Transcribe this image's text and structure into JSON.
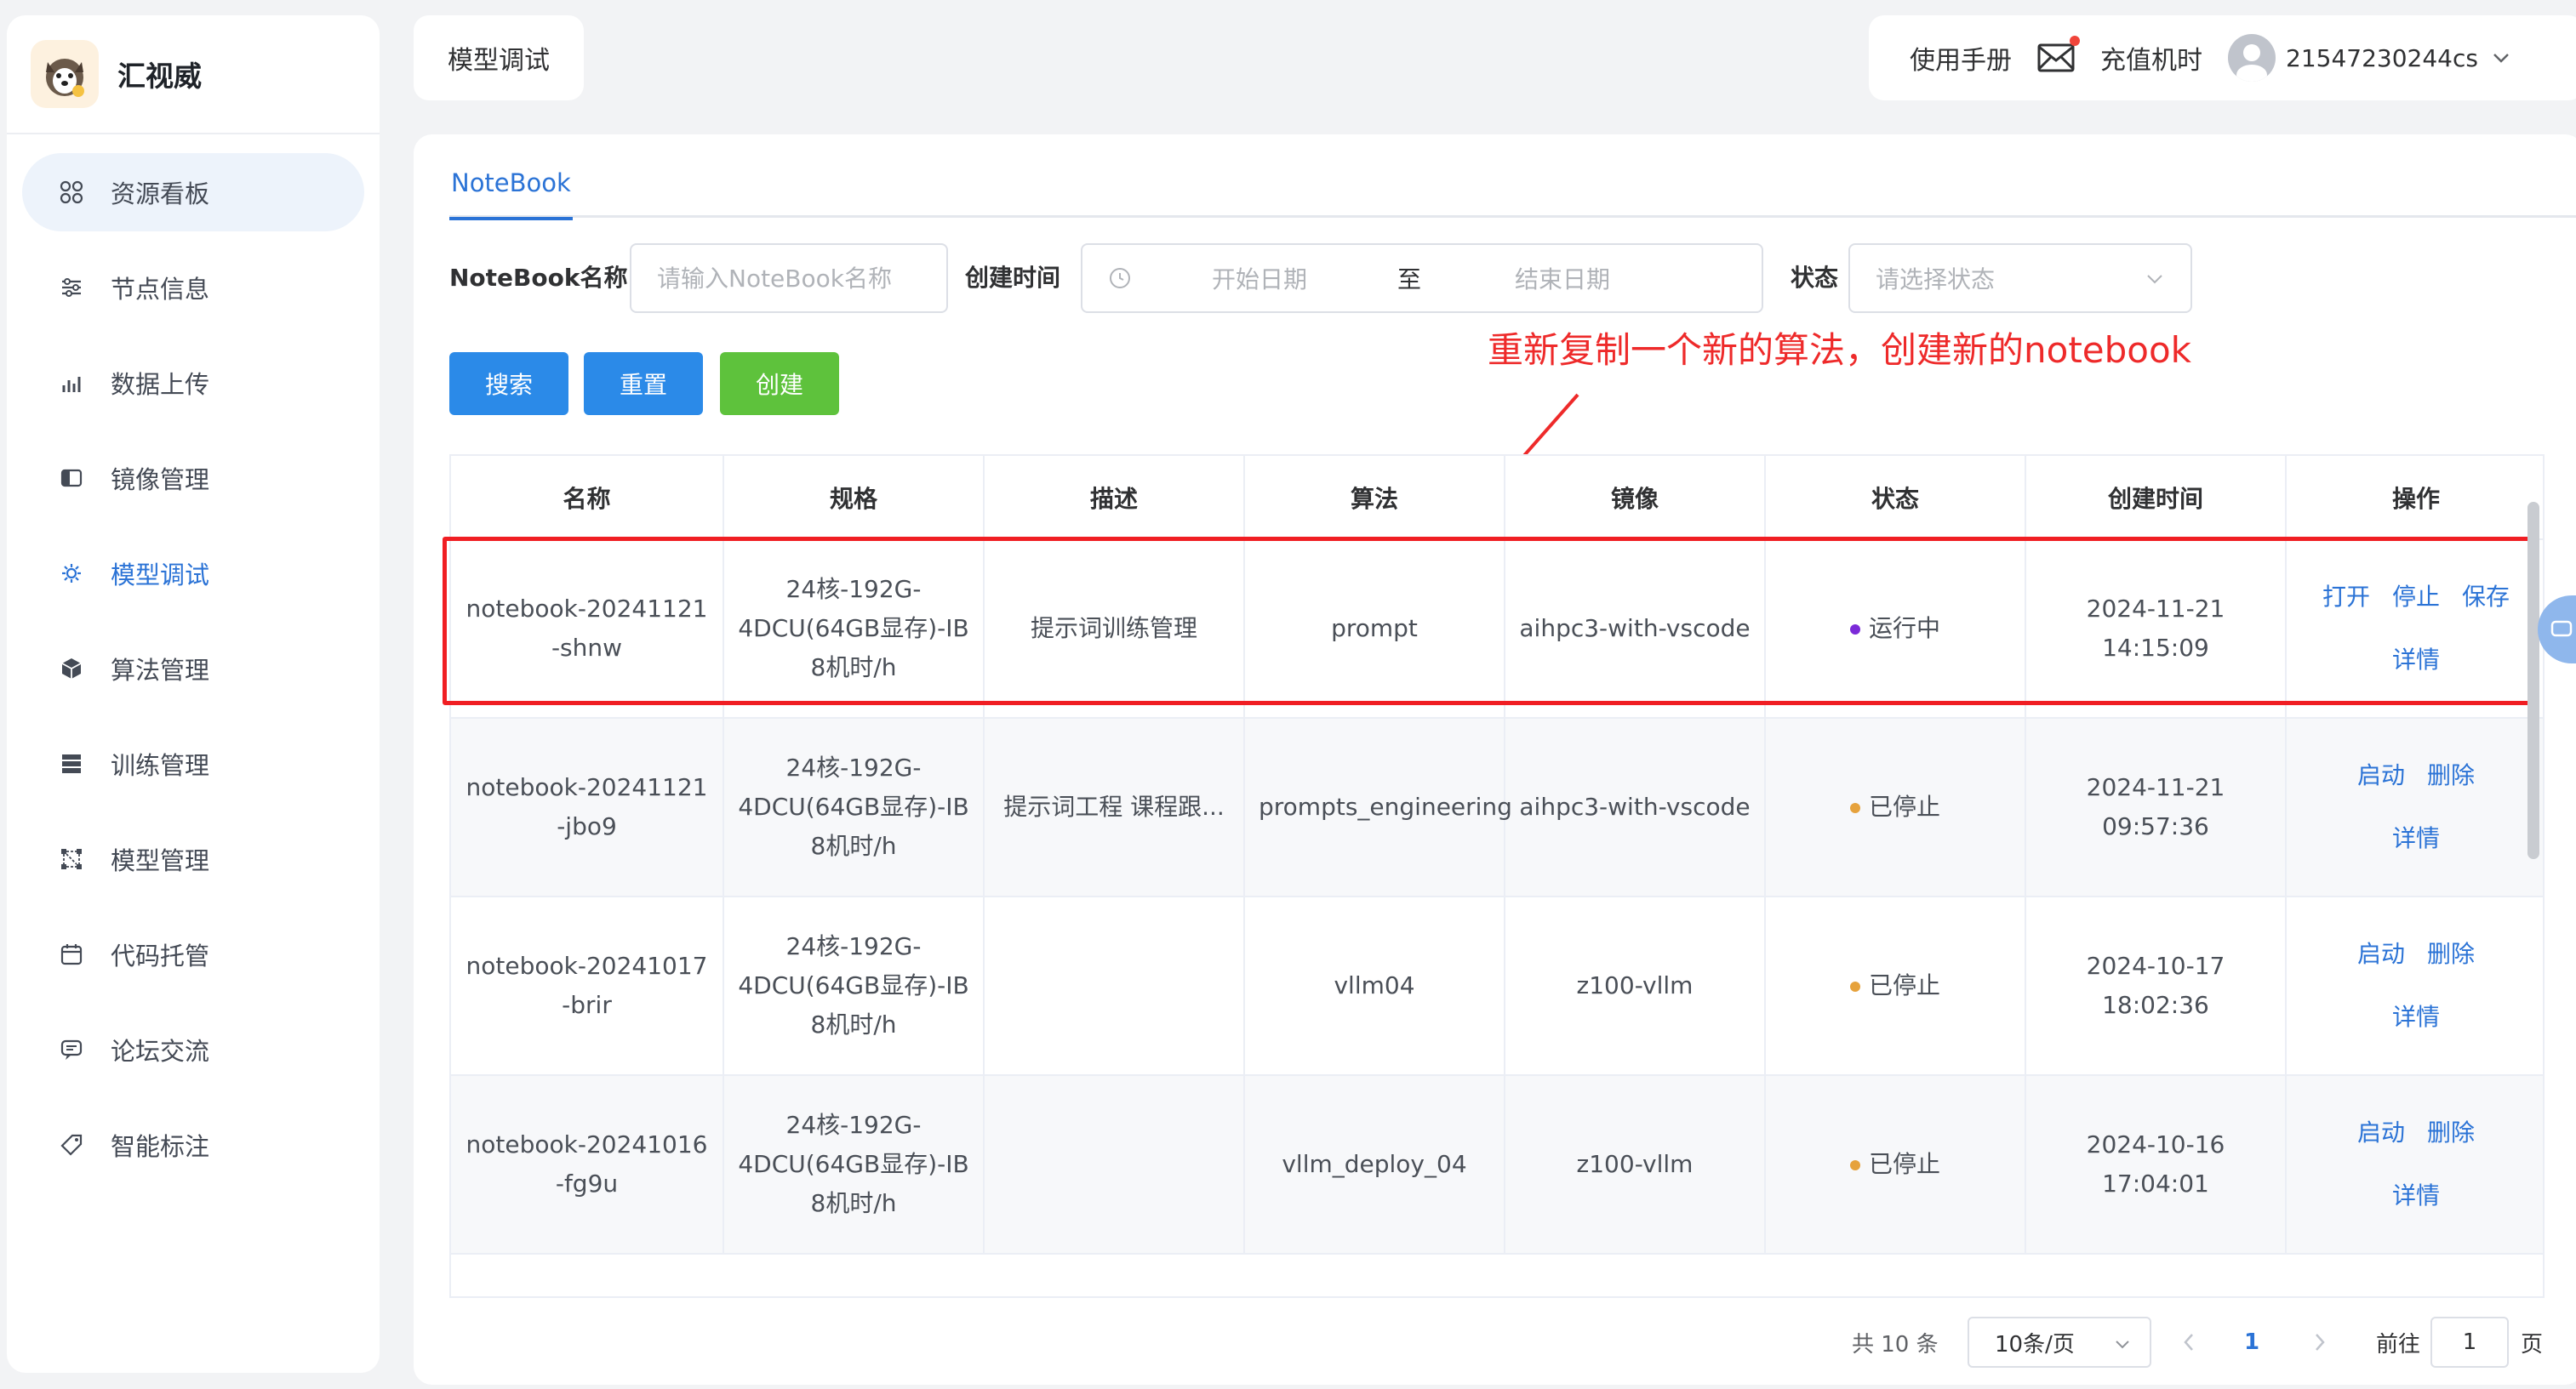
{
  "brand": {
    "name": "汇视威"
  },
  "sidebar": {
    "items": [
      {
        "label": "资源看板",
        "icon": "grid-icon"
      },
      {
        "label": "节点信息",
        "icon": "sliders-icon"
      },
      {
        "label": "数据上传",
        "icon": "bar-chart-icon"
      },
      {
        "label": "镜像管理",
        "icon": "image-icon"
      },
      {
        "label": "模型调试",
        "icon": "cog-icon"
      },
      {
        "label": "算法管理",
        "icon": "cube-icon"
      },
      {
        "label": "训练管理",
        "icon": "server-icon"
      },
      {
        "label": "模型管理",
        "icon": "nodes-icon"
      },
      {
        "label": "代码托管",
        "icon": "calendar-icon"
      },
      {
        "label": "论坛交流",
        "icon": "chat-icon"
      },
      {
        "label": "智能标注",
        "icon": "tag-icon"
      }
    ],
    "highlighted_bg_index": 0,
    "active_index": 4
  },
  "breadcrumb": {
    "label": "模型调试"
  },
  "header": {
    "manual": "使用手册",
    "recharge": "充值机时",
    "username": "21547230244cs"
  },
  "tabs": [
    {
      "label": "NoteBook"
    }
  ],
  "filter": {
    "name_label": "NoteBook名称",
    "name_placeholder": "请输入NoteBook名称",
    "time_label": "创建时间",
    "start_placeholder": "开始日期",
    "range_sep": "至",
    "end_placeholder": "结束日期",
    "status_label": "状态",
    "status_placeholder": "请选择状态"
  },
  "buttons": {
    "search": "搜索",
    "reset": "重置",
    "create": "创建"
  },
  "annotation": "重新复制一个新的算法，创建新的notebook",
  "table": {
    "columns": [
      "名称",
      "规格",
      "描述",
      "算法",
      "镜像",
      "状态",
      "创建时间",
      "操作"
    ],
    "rows": [
      {
        "name": "notebook-20241121-shnw",
        "spec": "24核-192G-4DCU(64GB显存)-IB 8机时/h",
        "desc": "提示词训练管理",
        "algo": "prompt",
        "image": "aihpc3-with-vscode",
        "status": "运行中",
        "status_color": "#7b2ad8",
        "created": "2024-11-21 14:15:09",
        "ops": [
          "打开",
          "停止",
          "保存"
        ],
        "ops2": [
          "详情"
        ]
      },
      {
        "name": "notebook-20241121-jbo9",
        "spec": "24核-192G-4DCU(64GB显存)-IB 8机时/h",
        "desc": "提示词工程 课程跟...",
        "algo": "prompts_engineering",
        "image": "aihpc3-with-vscode",
        "status": "已停止",
        "status_color": "#e6a23c",
        "created": "2024-11-21 09:57:36",
        "ops": [
          "启动",
          "删除"
        ],
        "ops2": [
          "详情"
        ]
      },
      {
        "name": "notebook-20241017-brir",
        "spec": "24核-192G-4DCU(64GB显存)-IB 8机时/h",
        "desc": "",
        "algo": "vllm04",
        "image": "z100-vllm",
        "status": "已停止",
        "status_color": "#e6a23c",
        "created": "2024-10-17 18:02:36",
        "ops": [
          "启动",
          "删除"
        ],
        "ops2": [
          "详情"
        ]
      },
      {
        "name": "notebook-20241016-fg9u",
        "spec": "24核-192G-4DCU(64GB显存)-IB 8机时/h",
        "desc": "",
        "algo": "vllm_deploy_04",
        "image": "z100-vllm",
        "status": "已停止",
        "status_color": "#e6a23c",
        "created": "2024-10-16 17:04:01",
        "ops": [
          "启动",
          "删除"
        ],
        "ops2": [
          "详情"
        ]
      }
    ]
  },
  "pagination": {
    "total": "共 10 条",
    "page_size": "10条/页",
    "current_page": "1",
    "goto_label": "前往",
    "goto_value": "1",
    "goto_suffix": "页"
  }
}
